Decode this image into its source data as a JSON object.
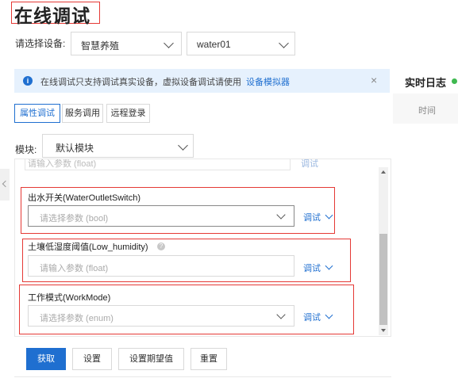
{
  "page": {
    "title": "在线调试"
  },
  "device_select": {
    "label": "请选择设备:",
    "product": "智慧养殖",
    "device": "water01"
  },
  "banner": {
    "text": "在线调试只支持调试真实设备，虚拟设备调试请使用",
    "link": "设备模拟器",
    "close": "×"
  },
  "realtime_log": {
    "title": "实时日志",
    "col_time": "时间"
  },
  "tabs": [
    {
      "label": "属性调试",
      "active": true
    },
    {
      "label": "服务调用",
      "active": false
    },
    {
      "label": "远程登录",
      "active": false
    }
  ],
  "module": {
    "label": "模块:",
    "value": "默认模块"
  },
  "prev_param": {
    "placeholder": "请输入参数 (float)",
    "debug": "调试"
  },
  "params": [
    {
      "label": "出水开关(WaterOutletSwitch)",
      "placeholder": "请选择参数 (bool)",
      "debug": "调试",
      "type": "select"
    },
    {
      "label": "土壤低湿度阈值(Low_humidity)",
      "placeholder": "请输入参数 (float)",
      "debug": "调试",
      "type": "input",
      "help": "?"
    },
    {
      "label": "工作模式(WorkMode)",
      "placeholder": "请选择参数 (enum)",
      "debug": "调试",
      "type": "select"
    }
  ],
  "actions": {
    "get": "获取",
    "set": "设置",
    "set_expected": "设置期望值",
    "reset": "重置"
  },
  "colors": {
    "primary": "#1f6fd0",
    "highlight": "#e53935",
    "banner_bg": "#e6f1fd",
    "status_online": "#3fb950"
  },
  "icons": [
    "info-icon",
    "close-icon",
    "chevron-down-icon",
    "help-icon",
    "status-dot-icon",
    "chevron-left-icon"
  ]
}
